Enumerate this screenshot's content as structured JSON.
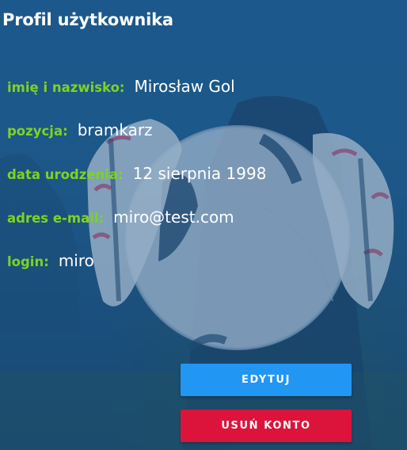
{
  "profile": {
    "title": "Profil użytkownika",
    "fields": [
      {
        "label": "imię i nazwisko:",
        "value": "Mirosław Gol"
      },
      {
        "label": "pozycja:",
        "value": "bramkarz"
      },
      {
        "label": "data urodzenia:",
        "value": "12 sierpnia 1998"
      },
      {
        "label": "adres e-mail:",
        "value": "miro@test.com"
      },
      {
        "label": "login:",
        "value": "miro"
      }
    ]
  },
  "actions": {
    "edit_label": "EDYTUJ",
    "delete_label": "USUŃ KONTO"
  },
  "colors": {
    "label_green": "#7ed321",
    "edit_blue": "#2196f3",
    "delete_red": "#dc143c",
    "background_blue": "#215d8e"
  }
}
